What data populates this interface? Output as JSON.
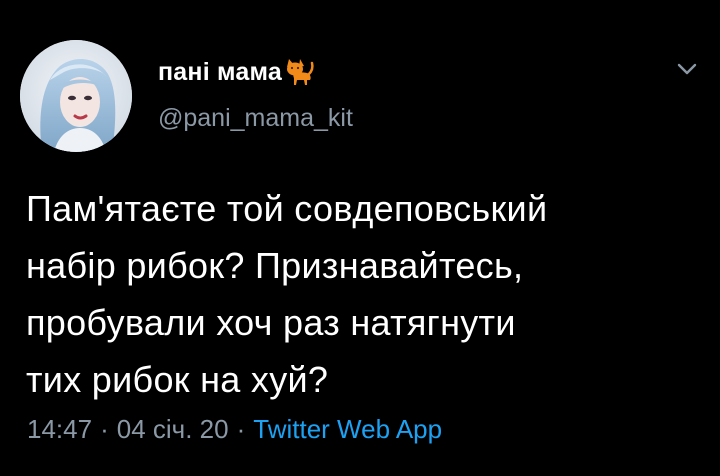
{
  "user": {
    "display_name": "пані мама",
    "name_emoji": "cat-emoji",
    "handle": "@pani_mama_kit"
  },
  "tweet": {
    "text": "Пам'ятаєте той совдеповський\nнабір рибок? Признавайтесь,\nпробували хоч раз натягнути\nтих рибок на хуй?",
    "time": "14:47",
    "separator": "·",
    "date": "04 січ. 20",
    "source": "Twitter Web App"
  },
  "icons": {
    "more": "chevron-down-icon"
  },
  "colors": {
    "background": "#000000",
    "text": "#ffffff",
    "secondary_text": "#8b98a5",
    "link": "#1da1f2"
  }
}
